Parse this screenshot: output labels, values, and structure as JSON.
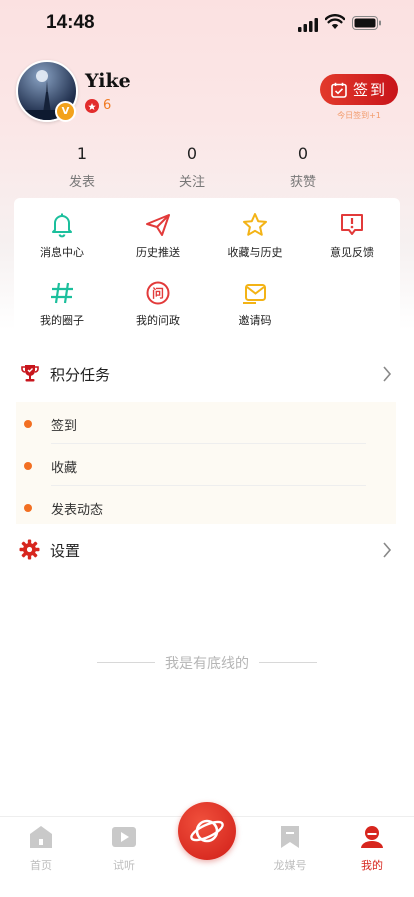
{
  "status_bar": {
    "time": "14:48"
  },
  "profile": {
    "name": "Yike",
    "level": "6",
    "verified_badge": "V"
  },
  "sign_in": {
    "label": "签到",
    "note": "今日签到+1"
  },
  "stats": [
    {
      "value": "1",
      "label": "发表"
    },
    {
      "value": "0",
      "label": "关注"
    },
    {
      "value": "0",
      "label": "获赞"
    }
  ],
  "quick_grid": [
    {
      "label": "消息中心",
      "icon": "bell-icon",
      "color": "#1bbf9c"
    },
    {
      "label": "历史推送",
      "icon": "send-icon",
      "color": "#e23a3a"
    },
    {
      "label": "收藏与历史",
      "icon": "star-icon",
      "color": "#f3b316"
    },
    {
      "label": "意见反馈",
      "icon": "feedback-icon",
      "color": "#e23a3a"
    },
    {
      "label": "我的圈子",
      "icon": "hashtag-icon",
      "color": "#1bbf9c"
    },
    {
      "label": "我的问政",
      "icon": "question-icon",
      "color": "#e23a3a"
    },
    {
      "label": "邀请码",
      "icon": "mail-icon",
      "color": "#f3b316"
    }
  ],
  "points_task": {
    "title": "积分任务",
    "items": [
      "签到",
      "收藏",
      "发表动态"
    ]
  },
  "settings": {
    "title": "设置"
  },
  "footer_text": "我是有底线的",
  "tabbar": {
    "items": [
      {
        "label": "首页",
        "icon": "home-icon"
      },
      {
        "label": "试听",
        "icon": "play-icon"
      },
      {
        "label": "",
        "icon": "planet-icon"
      },
      {
        "label": "龙媒号",
        "icon": "bookmark-icon"
      },
      {
        "label": "我的",
        "icon": "user-icon",
        "active": true
      }
    ]
  },
  "colors": {
    "brand_red": "#d7261e",
    "accent_orange": "#f26f22",
    "teal": "#1bbf9c",
    "yellow": "#f3b316"
  }
}
